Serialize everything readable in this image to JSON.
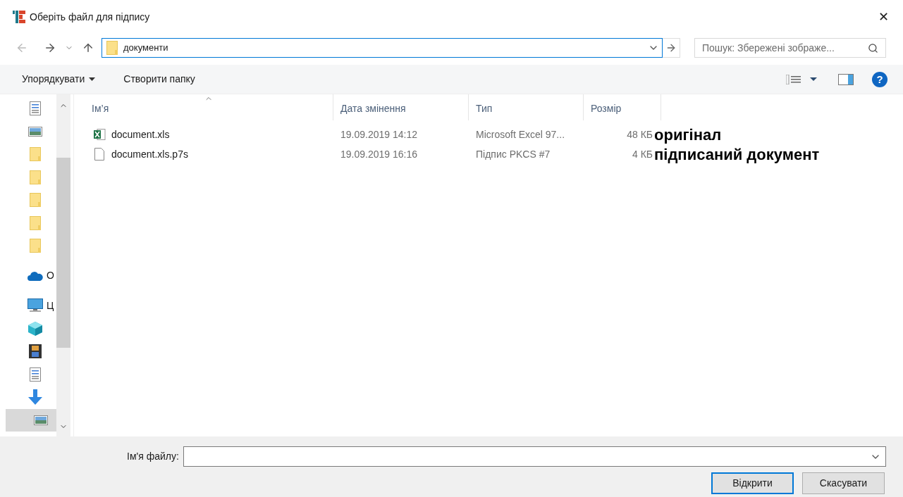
{
  "window": {
    "title": "Оберіть файл для підпису",
    "close": "✕"
  },
  "address": {
    "path": "документи"
  },
  "search": {
    "placeholder": "Пошук: Збережені зображе..."
  },
  "toolbar": {
    "organize": "Упорядкувати",
    "new_folder": "Створити папку",
    "help": "?"
  },
  "sidebar": {
    "items": [
      {
        "kind": "document",
        "selected": false
      },
      {
        "kind": "picture",
        "selected": false
      },
      {
        "kind": "folder",
        "selected": false
      },
      {
        "kind": "folder",
        "selected": false
      },
      {
        "kind": "folder",
        "selected": false
      },
      {
        "kind": "folder",
        "selected": false
      },
      {
        "kind": "folder",
        "selected": false
      },
      {
        "kind": "cloud",
        "label": "О",
        "selected": false
      },
      {
        "kind": "computer",
        "label": "Ц",
        "selected": false
      },
      {
        "kind": "cube",
        "selected": false
      },
      {
        "kind": "film",
        "selected": false
      },
      {
        "kind": "document",
        "selected": false
      },
      {
        "kind": "download",
        "selected": false
      },
      {
        "kind": "picture",
        "selected": true
      }
    ]
  },
  "table": {
    "columns": [
      "Ім’я",
      "Дата змінення",
      "Тип",
      "Розмір"
    ],
    "rows": [
      {
        "kind": "excel",
        "name": "document.xls",
        "date": "19.09.2019 14:12",
        "type": "Microsoft Excel 97...",
        "size": "48 КБ",
        "note": "оригінал"
      },
      {
        "kind": "file",
        "name": "document.xls.p7s",
        "date": "19.09.2019 16:16",
        "type": "Підпис PKCS #7",
        "size": "4 КБ",
        "note": "підписаний документ"
      }
    ]
  },
  "footer": {
    "filename_label": "Ім'я файлу:",
    "open": "Відкрити",
    "cancel": "Скасувати"
  }
}
